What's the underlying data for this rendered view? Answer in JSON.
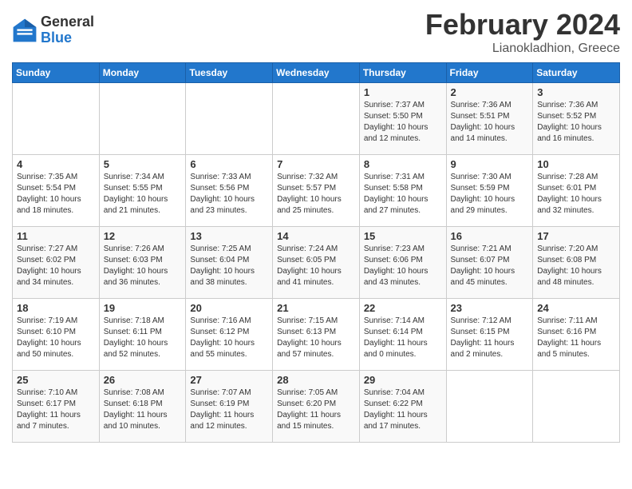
{
  "header": {
    "logo_general": "General",
    "logo_blue": "Blue",
    "month_year": "February 2024",
    "location": "Lianokladhion, Greece"
  },
  "days_of_week": [
    "Sunday",
    "Monday",
    "Tuesday",
    "Wednesday",
    "Thursday",
    "Friday",
    "Saturday"
  ],
  "weeks": [
    [
      {
        "day": "",
        "info": ""
      },
      {
        "day": "",
        "info": ""
      },
      {
        "day": "",
        "info": ""
      },
      {
        "day": "",
        "info": ""
      },
      {
        "day": "1",
        "info": "Sunrise: 7:37 AM\nSunset: 5:50 PM\nDaylight: 10 hours\nand 12 minutes."
      },
      {
        "day": "2",
        "info": "Sunrise: 7:36 AM\nSunset: 5:51 PM\nDaylight: 10 hours\nand 14 minutes."
      },
      {
        "day": "3",
        "info": "Sunrise: 7:36 AM\nSunset: 5:52 PM\nDaylight: 10 hours\nand 16 minutes."
      }
    ],
    [
      {
        "day": "4",
        "info": "Sunrise: 7:35 AM\nSunset: 5:54 PM\nDaylight: 10 hours\nand 18 minutes."
      },
      {
        "day": "5",
        "info": "Sunrise: 7:34 AM\nSunset: 5:55 PM\nDaylight: 10 hours\nand 21 minutes."
      },
      {
        "day": "6",
        "info": "Sunrise: 7:33 AM\nSunset: 5:56 PM\nDaylight: 10 hours\nand 23 minutes."
      },
      {
        "day": "7",
        "info": "Sunrise: 7:32 AM\nSunset: 5:57 PM\nDaylight: 10 hours\nand 25 minutes."
      },
      {
        "day": "8",
        "info": "Sunrise: 7:31 AM\nSunset: 5:58 PM\nDaylight: 10 hours\nand 27 minutes."
      },
      {
        "day": "9",
        "info": "Sunrise: 7:30 AM\nSunset: 5:59 PM\nDaylight: 10 hours\nand 29 minutes."
      },
      {
        "day": "10",
        "info": "Sunrise: 7:28 AM\nSunset: 6:01 PM\nDaylight: 10 hours\nand 32 minutes."
      }
    ],
    [
      {
        "day": "11",
        "info": "Sunrise: 7:27 AM\nSunset: 6:02 PM\nDaylight: 10 hours\nand 34 minutes."
      },
      {
        "day": "12",
        "info": "Sunrise: 7:26 AM\nSunset: 6:03 PM\nDaylight: 10 hours\nand 36 minutes."
      },
      {
        "day": "13",
        "info": "Sunrise: 7:25 AM\nSunset: 6:04 PM\nDaylight: 10 hours\nand 38 minutes."
      },
      {
        "day": "14",
        "info": "Sunrise: 7:24 AM\nSunset: 6:05 PM\nDaylight: 10 hours\nand 41 minutes."
      },
      {
        "day": "15",
        "info": "Sunrise: 7:23 AM\nSunset: 6:06 PM\nDaylight: 10 hours\nand 43 minutes."
      },
      {
        "day": "16",
        "info": "Sunrise: 7:21 AM\nSunset: 6:07 PM\nDaylight: 10 hours\nand 45 minutes."
      },
      {
        "day": "17",
        "info": "Sunrise: 7:20 AM\nSunset: 6:08 PM\nDaylight: 10 hours\nand 48 minutes."
      }
    ],
    [
      {
        "day": "18",
        "info": "Sunrise: 7:19 AM\nSunset: 6:10 PM\nDaylight: 10 hours\nand 50 minutes."
      },
      {
        "day": "19",
        "info": "Sunrise: 7:18 AM\nSunset: 6:11 PM\nDaylight: 10 hours\nand 52 minutes."
      },
      {
        "day": "20",
        "info": "Sunrise: 7:16 AM\nSunset: 6:12 PM\nDaylight: 10 hours\nand 55 minutes."
      },
      {
        "day": "21",
        "info": "Sunrise: 7:15 AM\nSunset: 6:13 PM\nDaylight: 10 hours\nand 57 minutes."
      },
      {
        "day": "22",
        "info": "Sunrise: 7:14 AM\nSunset: 6:14 PM\nDaylight: 11 hours\nand 0 minutes."
      },
      {
        "day": "23",
        "info": "Sunrise: 7:12 AM\nSunset: 6:15 PM\nDaylight: 11 hours\nand 2 minutes."
      },
      {
        "day": "24",
        "info": "Sunrise: 7:11 AM\nSunset: 6:16 PM\nDaylight: 11 hours\nand 5 minutes."
      }
    ],
    [
      {
        "day": "25",
        "info": "Sunrise: 7:10 AM\nSunset: 6:17 PM\nDaylight: 11 hours\nand 7 minutes."
      },
      {
        "day": "26",
        "info": "Sunrise: 7:08 AM\nSunset: 6:18 PM\nDaylight: 11 hours\nand 10 minutes."
      },
      {
        "day": "27",
        "info": "Sunrise: 7:07 AM\nSunset: 6:19 PM\nDaylight: 11 hours\nand 12 minutes."
      },
      {
        "day": "28",
        "info": "Sunrise: 7:05 AM\nSunset: 6:20 PM\nDaylight: 11 hours\nand 15 minutes."
      },
      {
        "day": "29",
        "info": "Sunrise: 7:04 AM\nSunset: 6:22 PM\nDaylight: 11 hours\nand 17 minutes."
      },
      {
        "day": "",
        "info": ""
      },
      {
        "day": "",
        "info": ""
      }
    ]
  ]
}
